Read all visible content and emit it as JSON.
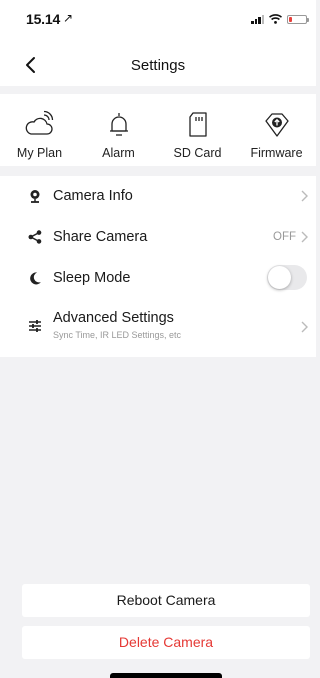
{
  "status_bar": {
    "time": "15.14",
    "location_glyph": "↗",
    "battery_level": 0.18,
    "battery_color": "#e8413c"
  },
  "nav": {
    "title": "Settings"
  },
  "quick_actions": [
    {
      "label": "My Plan",
      "icon": "cloud-plan-icon"
    },
    {
      "label": "Alarm",
      "icon": "bell-icon"
    },
    {
      "label": "SD Card",
      "icon": "sd-card-icon"
    },
    {
      "label": "Firmware",
      "icon": "firmware-icon"
    }
  ],
  "settings": [
    {
      "label": "Camera Info",
      "icon": "camera-icon"
    },
    {
      "label": "Share Camera",
      "icon": "share-icon",
      "value": "OFF"
    },
    {
      "label": "Sleep Mode",
      "icon": "sleep-moon-icon",
      "toggle_on": false
    },
    {
      "label": "Advanced  Settings",
      "icon": "sliders-icon",
      "subtitle": "Sync Time, IR LED Settings, etc"
    }
  ],
  "buttons": {
    "reboot": "Reboot Camera",
    "delete": "Delete Camera"
  },
  "colors": {
    "danger": "#e53935",
    "background": "#f2f2f4"
  }
}
